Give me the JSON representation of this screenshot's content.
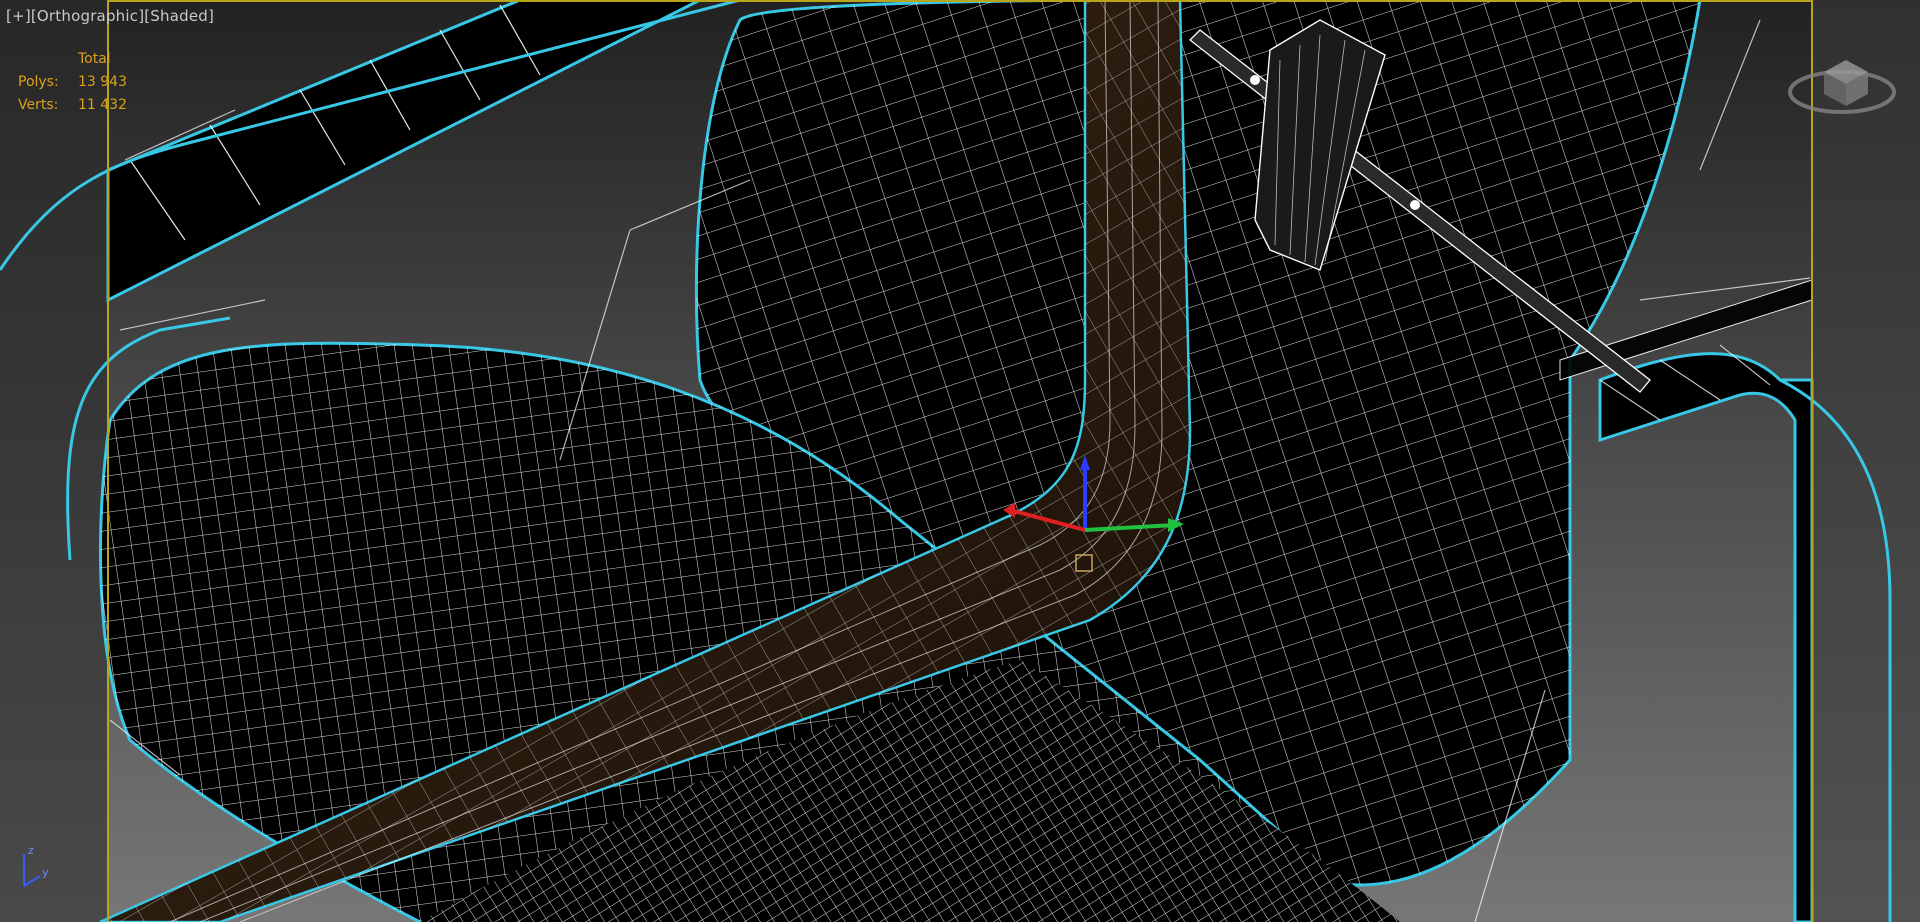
{
  "viewport": {
    "label_parts": [
      "[+]",
      "[Orthographic]",
      "[Shaded]"
    ],
    "stats": {
      "header": "Total",
      "rows": [
        {
          "label": "Polys:",
          "value": "13 943"
        },
        {
          "label": "Verts:",
          "value": "11 432"
        }
      ]
    },
    "axis_labels": {
      "z": "z",
      "y": "y"
    },
    "colors": {
      "background": "#000000",
      "wire": "#ffffff",
      "selected_outline": "#38c8e6",
      "safe_frame": "#b8a51c",
      "stats_text": "#d9a21a",
      "label_text": "#c9c9c9"
    }
  }
}
